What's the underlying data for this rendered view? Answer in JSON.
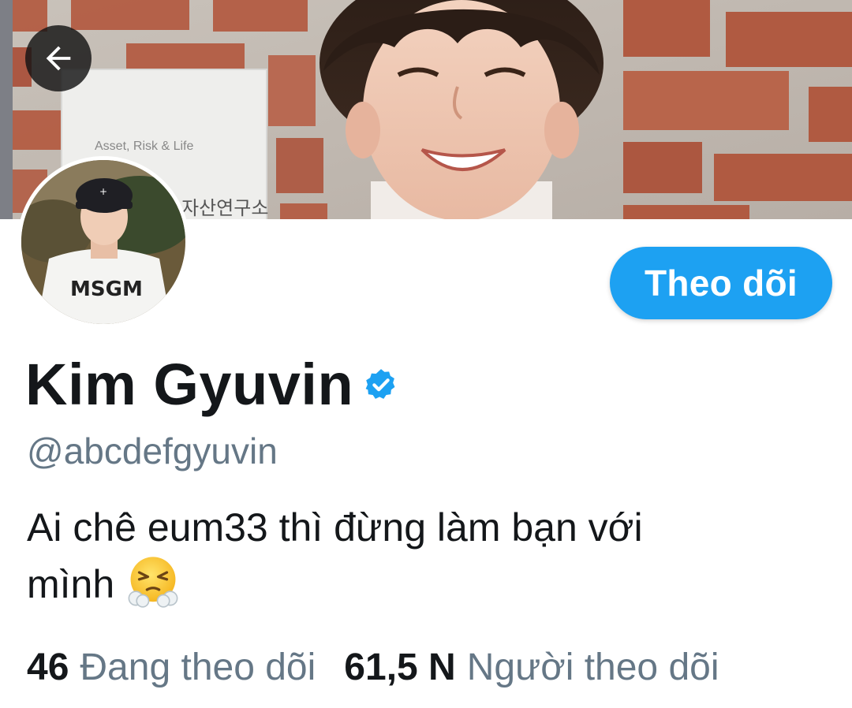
{
  "header": {
    "back_icon": "arrow-left-icon",
    "banner_image": "banner-photo",
    "colors": {
      "back_button_bg": "#141414",
      "accent": "#1da1f2"
    }
  },
  "profile": {
    "avatar_image": "avatar-photo",
    "display_name": "Kim Gyuvin",
    "verified": true,
    "verified_icon": "verified-badge-icon",
    "handle": "@abcdefgyuvin",
    "bio_line_1": "Ai chê eum33 thì đừng làm bạn với",
    "bio_line_2": "mình",
    "bio_emoji": "face-with-steam-from-nose-emoji"
  },
  "actions": {
    "follow_label": "Theo dõi"
  },
  "stats": {
    "following_count": "46",
    "following_label": "Đang theo dõi",
    "followers_count": "61,5 N",
    "followers_label": "Người theo dõi"
  },
  "colors": {
    "text_primary": "#14171a",
    "text_secondary": "#657786",
    "follow_button": "#1da1f2",
    "verified_badge": "#1da1f2"
  }
}
